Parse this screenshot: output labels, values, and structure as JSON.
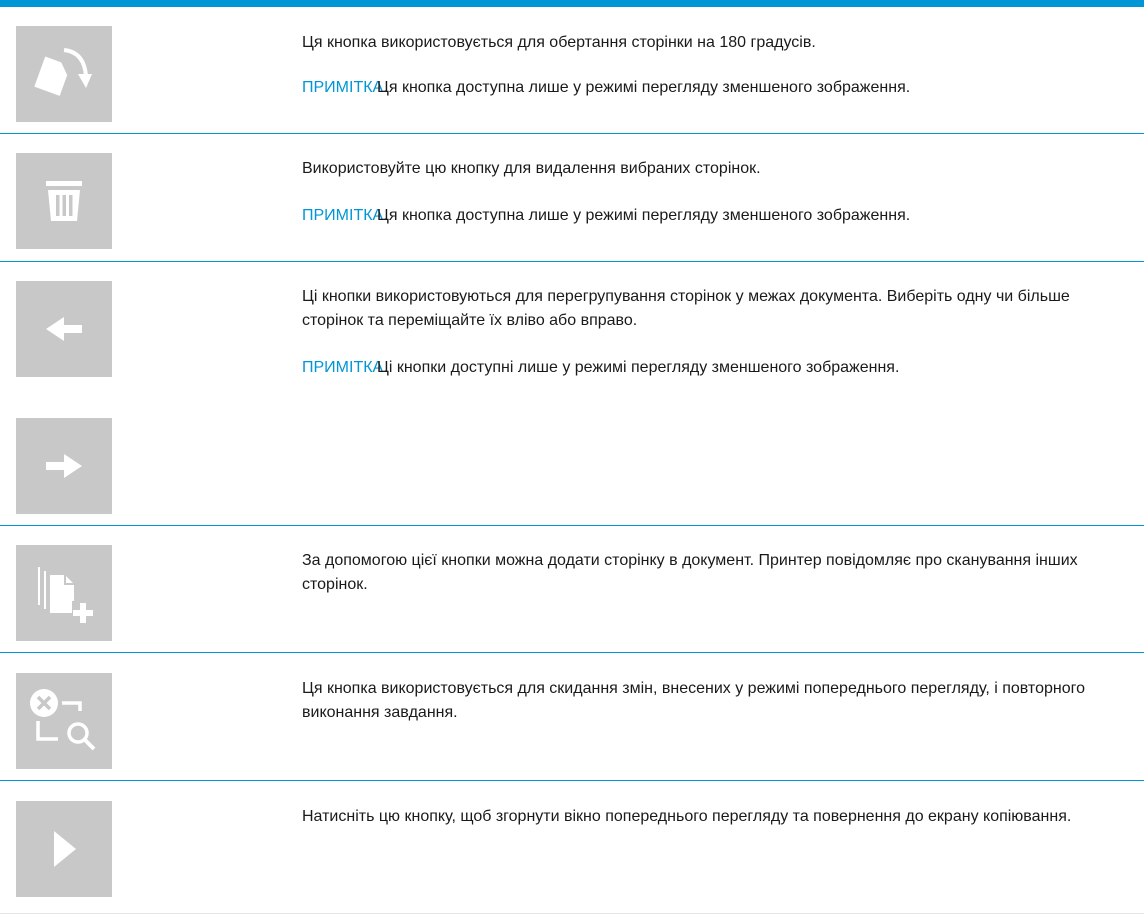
{
  "rows": [
    {
      "icon": "rotate-page-icon",
      "description": "Ця кнопка використовується для обертання сторінки на 180 градусів.",
      "note_label": "ПРИМІТКА.",
      "note_text": "Ця кнопка доступна лише у режимі перегляду зменшеного зображення."
    },
    {
      "icon": "trash-icon",
      "description": "Використовуйте цю кнопку для видалення вибраних сторінок.",
      "note_label": "ПРИМІТКА.",
      "note_text": "Ця кнопка доступна лише у режимі перегляду зменшеного зображення."
    },
    {
      "icon": "arrow-left-icon",
      "icon_2": "arrow-right-icon",
      "description": "Ці кнопки використовуються для перегрупування сторінок у межах документа. Виберіть одну чи більше сторінок та переміщайте їх вліво або вправо.",
      "note_label": "ПРИМІТКА.",
      "note_text": "Ці кнопки доступні лише у режимі перегляду зменшеного зображення."
    },
    {
      "icon": "add-page-icon",
      "description": "За допомогою цієї кнопки можна додати сторінку в документ. Принтер повідомляє про сканування інших сторінок."
    },
    {
      "icon": "reset-preview-icon",
      "description": "Ця кнопка використовується для скидання змін, внесених у режимі попереднього перегляду, і повторного виконання завдання."
    },
    {
      "icon": "play-icon",
      "description": "Натисніть цю кнопку, щоб згорнути вікно попереднього перегляду та повернення до екрану копіювання."
    }
  ],
  "colors": {
    "accent": "#0096d6",
    "button_bg": "#c8c8c8",
    "icon": "#ffffff"
  }
}
